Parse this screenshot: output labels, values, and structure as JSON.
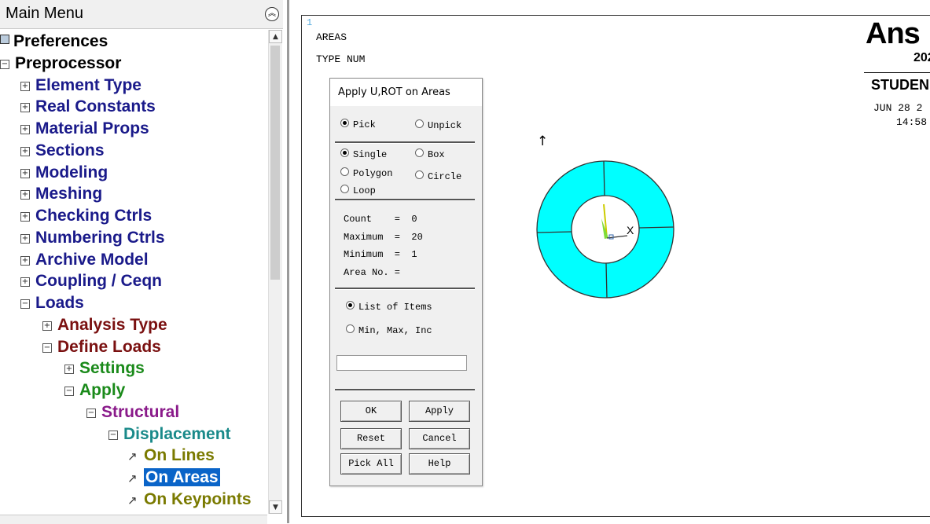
{
  "menu": {
    "title": "Main Menu",
    "collapse_icon": "double-chevron-up-icon",
    "items": [
      {
        "label": "Preferences",
        "level": 0,
        "icon": "prefs",
        "color": "black"
      },
      {
        "label": "Preprocessor",
        "level": 0,
        "icon": "minus",
        "color": "black"
      },
      {
        "label": "Element Type",
        "level": 1,
        "icon": "plus",
        "color": "navy"
      },
      {
        "label": "Real Constants",
        "level": 1,
        "icon": "plus",
        "color": "navy"
      },
      {
        "label": "Material Props",
        "level": 1,
        "icon": "plus",
        "color": "navy"
      },
      {
        "label": "Sections",
        "level": 1,
        "icon": "plus",
        "color": "navy"
      },
      {
        "label": "Modeling",
        "level": 1,
        "icon": "plus",
        "color": "navy"
      },
      {
        "label": "Meshing",
        "level": 1,
        "icon": "plus",
        "color": "navy"
      },
      {
        "label": "Checking Ctrls",
        "level": 1,
        "icon": "plus",
        "color": "navy"
      },
      {
        "label": "Numbering Ctrls",
        "level": 1,
        "icon": "plus",
        "color": "navy"
      },
      {
        "label": "Archive Model",
        "level": 1,
        "icon": "plus",
        "color": "navy"
      },
      {
        "label": "Coupling / Ceqn",
        "level": 1,
        "icon": "plus",
        "color": "navy"
      },
      {
        "label": "Loads",
        "level": 1,
        "icon": "minus",
        "color": "navy"
      },
      {
        "label": "Analysis Type",
        "level": 2,
        "icon": "plus",
        "color": "red"
      },
      {
        "label": "Define Loads",
        "level": 2,
        "icon": "minus",
        "color": "red"
      },
      {
        "label": "Settings",
        "level": 3,
        "icon": "plus",
        "color": "green"
      },
      {
        "label": "Apply",
        "level": 3,
        "icon": "minus",
        "color": "green"
      },
      {
        "label": "Structural",
        "level": 4,
        "icon": "minus",
        "color": "purple"
      },
      {
        "label": "Displacement",
        "level": 5,
        "icon": "minus",
        "color": "teal"
      },
      {
        "label": "On Lines",
        "level": 6,
        "icon": "arrow",
        "color": "olive"
      },
      {
        "label": "On Areas",
        "level": 6,
        "icon": "arrow",
        "color": "olive",
        "selected": true
      },
      {
        "label": "On Keypoints",
        "level": 6,
        "icon": "arrow",
        "color": "olive"
      }
    ]
  },
  "graphics": {
    "window_number": "1",
    "plot_label": "AREAS",
    "type_label": "TYPE NUM",
    "logo": "Ans",
    "version": "202",
    "edition": "STUDEN",
    "date": "JUN 28 2",
    "time": "14:58",
    "axis_label": "X",
    "ring_color": "#00ffff"
  },
  "dialog": {
    "title": "Apply U,ROT on Areas",
    "pick": "Pick",
    "unpick": "Unpick",
    "single": "Single",
    "box": "Box",
    "polygon": "Polygon",
    "circle": "Circle",
    "loop": "Loop",
    "count": "Count    =  0",
    "maximum": "Maximum  =  20",
    "minimum": "Minimum  =  1",
    "area_no": "Area No. =",
    "list_items": "List of Items",
    "min_max_inc": "Min, Max, Inc",
    "input_value": "",
    "ok": "OK",
    "apply": "Apply",
    "reset": "Reset",
    "cancel": "Cancel",
    "pick_all": "Pick All",
    "help": "Help"
  }
}
